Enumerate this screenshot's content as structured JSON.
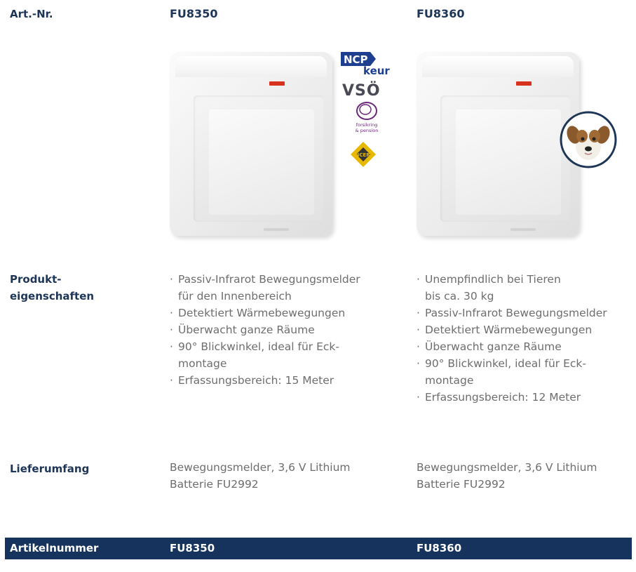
{
  "header": {
    "label": "Art.-Nr.",
    "col1": "FU8350",
    "col2": "FU8360"
  },
  "badges": {
    "ncp": "NCP",
    "keur": "keur",
    "vso": "VSÖ",
    "forsikring_line1": "forsikring",
    "forsikring_line2": "& pension",
    "incert": "INCERT"
  },
  "features": {
    "label_line1": "Produkt-",
    "label_line2": "eigenschaften",
    "col1": [
      [
        "Passiv-Infrarot Bewegungsmelder",
        "für den Innenbereich"
      ],
      [
        "Detektiert Wärmebewegungen"
      ],
      [
        "Überwacht ganze Räume"
      ],
      [
        "90° Blickwinkel, ideal für Eck-",
        "montage"
      ],
      [
        "Erfassungsbereich: 15 Meter"
      ]
    ],
    "col2": [
      [
        "Unempfindlich bei Tieren",
        "bis ca. 30 kg"
      ],
      [
        "Passiv-Infrarot Bewegungsmelder"
      ],
      [
        "Detektiert Wärmebewegungen"
      ],
      [
        "Überwacht ganze Räume"
      ],
      [
        "90° Blickwinkel, ideal für Eck-",
        "montage"
      ],
      [
        "Erfassungsbereich: 12 Meter"
      ]
    ]
  },
  "delivery": {
    "label": "Lieferumfang",
    "col1_line1": "Bewegungsmelder, 3,6 V Lithium",
    "col1_line2": "Batterie FU2992",
    "col2_line1": "Bewegungsmelder, 3,6 V Lithium",
    "col2_line2": "Batterie FU2992"
  },
  "footer": {
    "label": "Artikelnummer",
    "col1": "FU8350",
    "col2": "FU8360"
  }
}
